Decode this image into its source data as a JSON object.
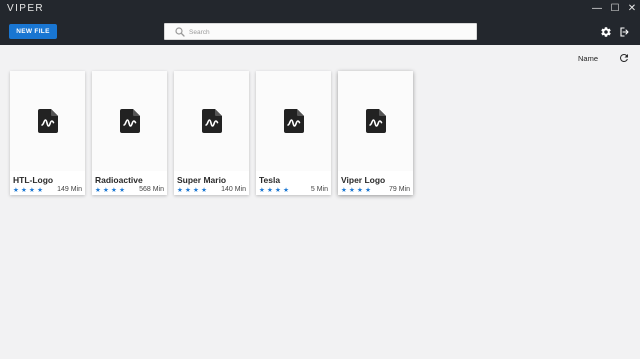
{
  "app": {
    "title": "VIPER"
  },
  "window_controls": {
    "minimize": "—",
    "maximize": "☐",
    "close": "✕"
  },
  "toolbar": {
    "new_file_label": "NEW FILE",
    "search_placeholder": "Search"
  },
  "sort": {
    "label": "Name"
  },
  "accent_color": "#1976d2",
  "cards": [
    {
      "title": "HTL-Logo",
      "rating": 4,
      "stars": "★★★★",
      "duration": "149 Min"
    },
    {
      "title": "Radioactive",
      "rating": 4,
      "stars": "★★★★",
      "duration": "568 Min"
    },
    {
      "title": "Super Mario",
      "rating": 4,
      "stars": "★★★★",
      "duration": "140 Min"
    },
    {
      "title": "Tesla",
      "rating": 4,
      "stars": "★★★★",
      "duration": "5 Min"
    },
    {
      "title": "Viper Logo",
      "rating": 4,
      "stars": "★★★★",
      "duration": "79 Min",
      "selected": true
    }
  ],
  "icons": {
    "search": "search-icon",
    "settings": "gear-icon",
    "logout": "logout-icon",
    "refresh": "refresh-icon",
    "file": "audio-file-icon"
  }
}
